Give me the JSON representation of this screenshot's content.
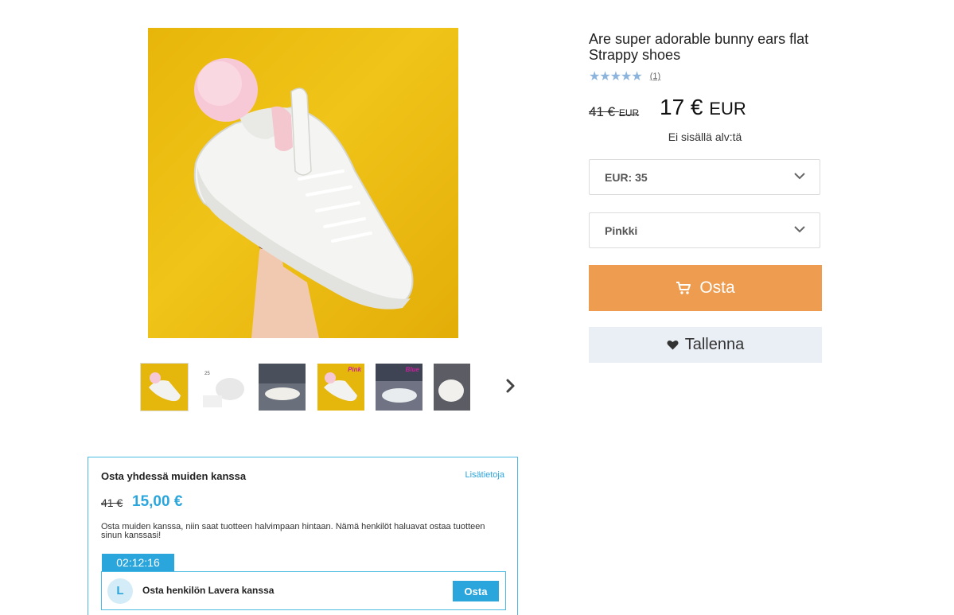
{
  "product": {
    "title": "Are super adorable bunny ears flat Strappy shoes",
    "stars": "★★★★★",
    "review_count": "(1)",
    "old_price": "41 €",
    "old_price_currency": "EUR",
    "price": "17 €",
    "price_currency": "EUR",
    "vat_note": "Ei sisällä alv:tä"
  },
  "options": {
    "size_value": "EUR: 35",
    "color_value": "Pinkki"
  },
  "actions": {
    "buy_label": "Osta",
    "save_label": "Tallenna"
  },
  "thumbnails": {
    "labels": [
      "Pink",
      "Blue"
    ]
  },
  "group_buy": {
    "title": "Osta yhdessä muiden kanssa",
    "more_link": "Lisätietoja",
    "old_price": "41 €",
    "price": "15,00 €",
    "description": "Osta muiden kanssa, niin saat tuotteen halvimpaan hintaan. Nämä henkilöt haluavat ostaa tuotteen sinun kanssasi!",
    "timer": "02:12:16",
    "avatar_initial": "L",
    "partner_text": "Osta henkilön Lavera kanssa",
    "partner_buy": "Osta"
  },
  "colors": {
    "accent_orange": "#ed9c50",
    "accent_blue": "#2ba6dd",
    "save_bg": "#eaeef5",
    "star_color": "#8cb4dc"
  },
  "icons": [
    "cart-icon",
    "heart-icon",
    "chevron-down-icon",
    "chevron-right-icon"
  ]
}
